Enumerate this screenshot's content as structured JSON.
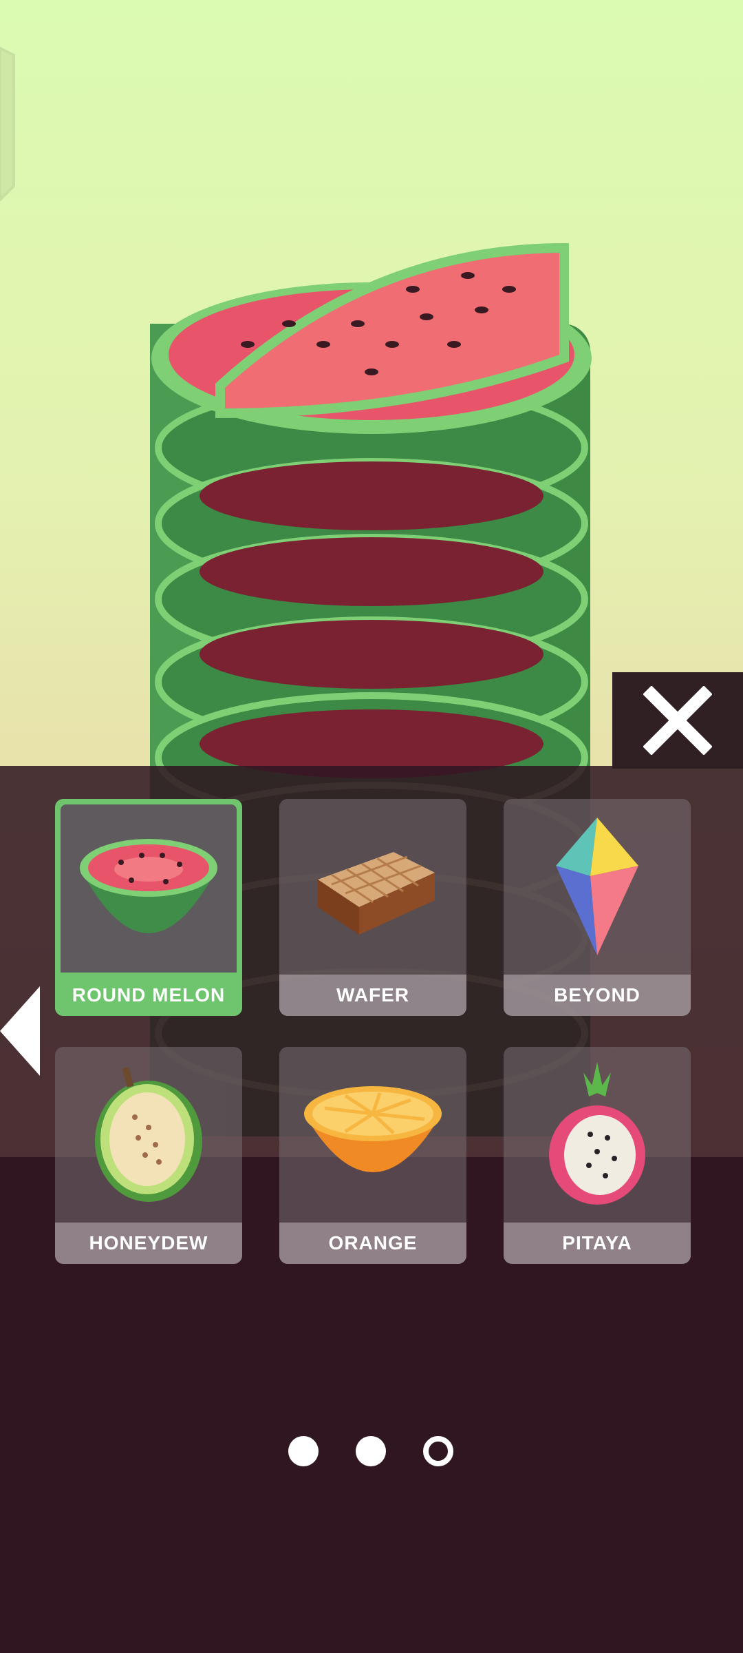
{
  "colors": {
    "accent": "#6fc46e",
    "overlay": "#2f1720"
  },
  "skins": [
    {
      "label": "ROUND MELON",
      "icon": "round-melon-icon",
      "selected": true
    },
    {
      "label": "WAFER",
      "icon": "wafer-icon",
      "selected": false
    },
    {
      "label": "BEYOND",
      "icon": "beyond-crystal-icon",
      "selected": false
    },
    {
      "label": "HONEYDEW",
      "icon": "honeydew-icon",
      "selected": false
    },
    {
      "label": "ORANGE",
      "icon": "orange-icon",
      "selected": false
    },
    {
      "label": "PITAYA",
      "icon": "pitaya-icon",
      "selected": false
    }
  ],
  "pagination": {
    "pages": 3,
    "current": 3
  }
}
